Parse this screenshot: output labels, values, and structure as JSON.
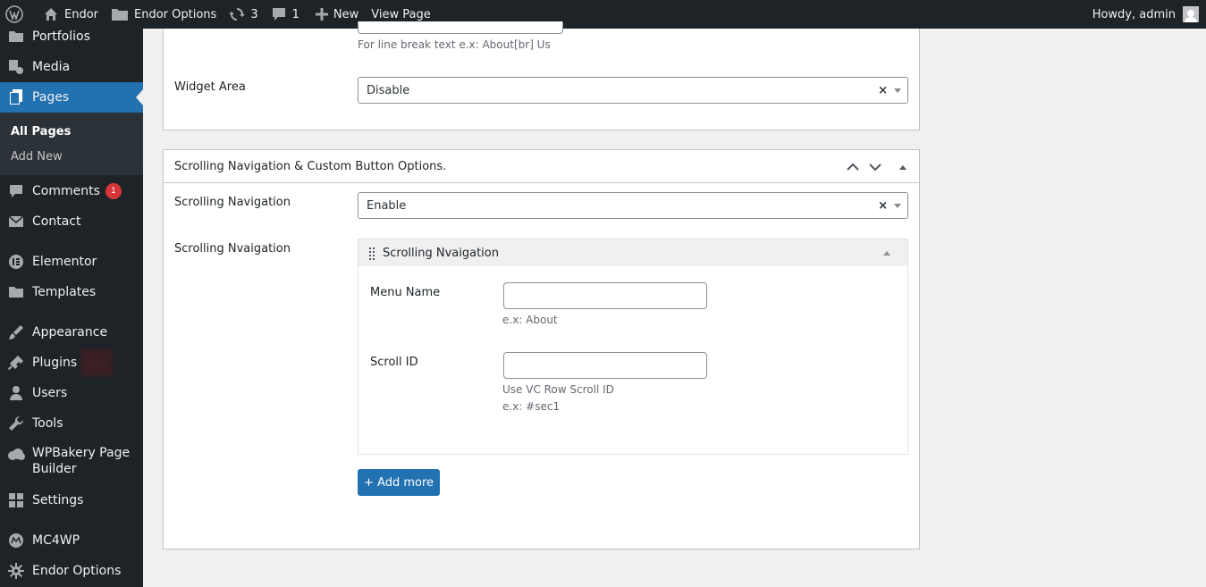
{
  "adminbar": {
    "site_name": "Endor",
    "options": "Endor Options",
    "updates_count": "3",
    "comments_count": "1",
    "new_label": "New",
    "view_page": "View Page",
    "greeting": "Howdy, admin"
  },
  "sidebar": {
    "items": [
      {
        "label": "Portfolios"
      },
      {
        "label": "Media"
      },
      {
        "label": "Pages"
      },
      {
        "label": "Comments",
        "badge": "1"
      },
      {
        "label": "Contact"
      },
      {
        "label": "Elementor"
      },
      {
        "label": "Templates"
      },
      {
        "label": "Appearance"
      },
      {
        "label": "Plugins"
      },
      {
        "label": "Users"
      },
      {
        "label": "Tools"
      },
      {
        "label": "WPBakery Page",
        "label2": "Builder"
      },
      {
        "label": "Settings"
      },
      {
        "label": "MC4WP"
      },
      {
        "label": "Endor Options"
      }
    ],
    "submenu": [
      "All Pages",
      "Add New"
    ]
  },
  "box1": {
    "line_break_desc": "For line break text e.x: About[br] Us",
    "widget_area_label": "Widget Area",
    "widget_area_value": "Disable",
    "clear_symbol": "×"
  },
  "box2": {
    "title": "Scrolling Navigation & Custom Button Options.",
    "scroll_nav_label": "Scrolling Navigation",
    "scroll_nav_value": "Enable",
    "repeater_label": "Scrolling Nvaigation",
    "repeater_title": "Scrolling Nvaigation",
    "menu_name_label": "Menu Name",
    "menu_name_value": "",
    "menu_name_desc": "e.x: About",
    "scroll_id_label": "Scroll ID",
    "scroll_id_value": "",
    "scroll_id_desc1": "Use VC Row Scroll ID",
    "scroll_id_desc2": "e.x: #sec1",
    "add_more": "+ Add more"
  },
  "colors": {
    "sidebar_bg": "#1d2327",
    "accent": "#2271b1",
    "badge": "#d63638"
  }
}
